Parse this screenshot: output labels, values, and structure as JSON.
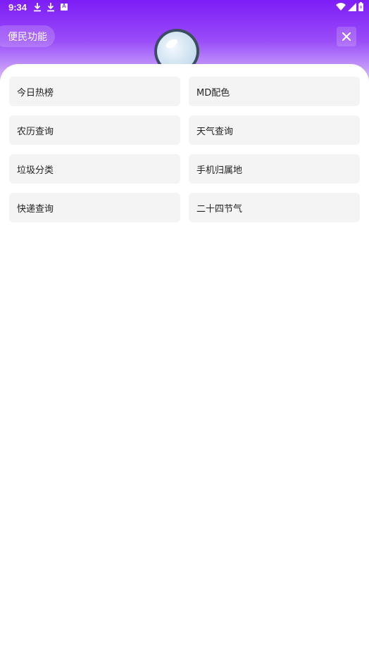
{
  "status_bar": {
    "time": "9:34",
    "icons": [
      "download-icon",
      "download-icon",
      "app-a-icon"
    ],
    "system_icons": [
      "wifi-icon",
      "signal-icon",
      "battery-icon"
    ]
  },
  "header": {
    "title": "便民功能",
    "close_icon": "close-icon",
    "colors": {
      "gradient_top": "#7d1cf7",
      "gradient_bottom": "#e9dcfd"
    }
  },
  "functions": [
    {
      "label": "今日热榜"
    },
    {
      "label": "MD配色"
    },
    {
      "label": "农历查询"
    },
    {
      "label": "天气查询"
    },
    {
      "label": "垃圾分类"
    },
    {
      "label": "手机归属地"
    },
    {
      "label": "快递查询"
    },
    {
      "label": "二十四节气"
    }
  ]
}
